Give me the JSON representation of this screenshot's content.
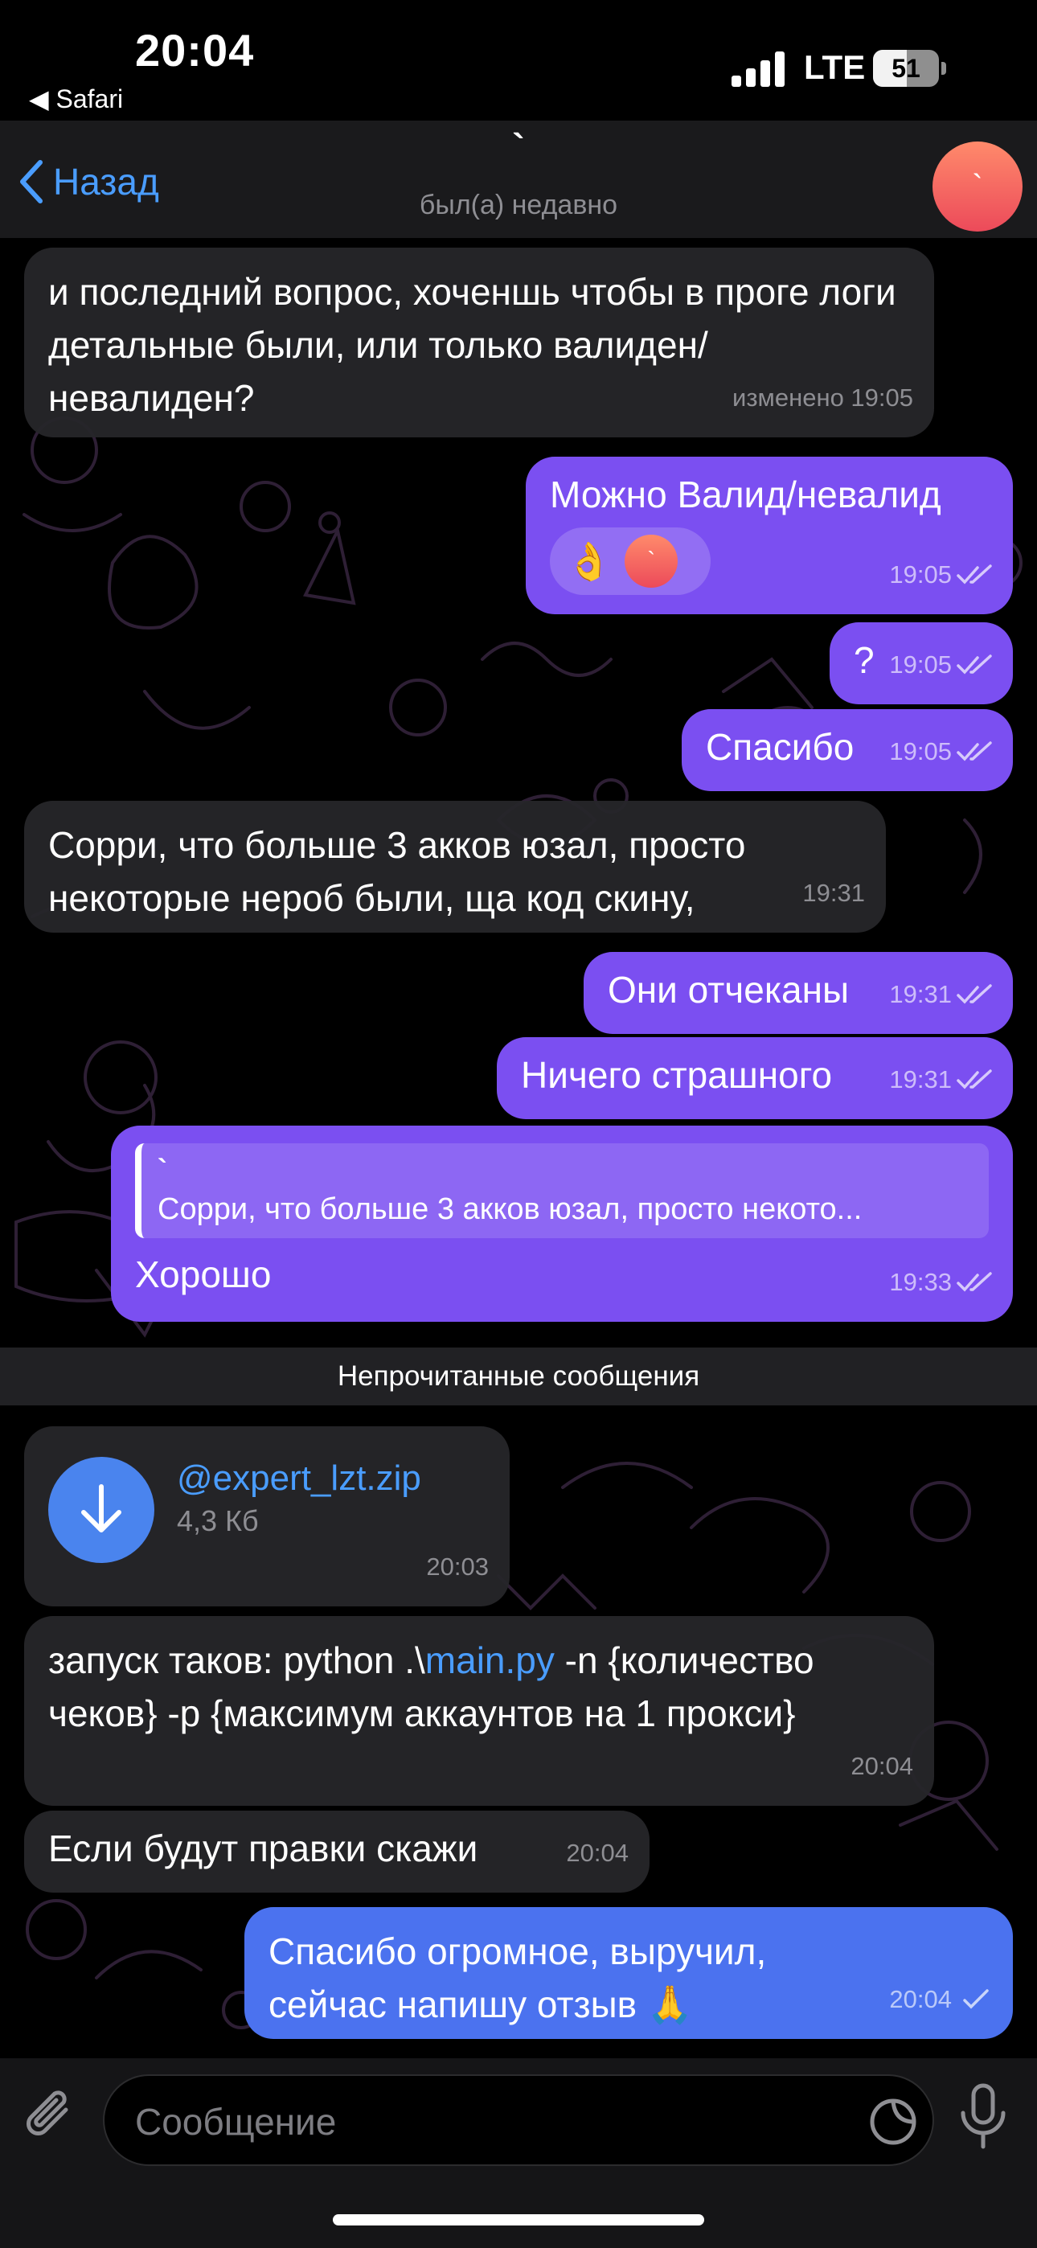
{
  "status_bar": {
    "time": "20:04",
    "back_app": "◀ Safari",
    "network": "LTE",
    "battery": "51",
    "battery_level": 0.51
  },
  "header": {
    "back_label": "Назад",
    "chat_name": "`",
    "status": "был(а) недавно",
    "avatar_letter": "`"
  },
  "messages": [
    {
      "dir": "in",
      "text": "и последний вопрос, хоченшь чтобы в проге логи детальные были, или только валиден/невалиден?",
      "time": "изменено 19:05"
    },
    {
      "dir": "out",
      "text": "Можно Валид/невалид",
      "time": "19:05",
      "reaction_emoji": "👌",
      "reaction_avatar": "`"
    },
    {
      "dir": "out",
      "text": "?",
      "time": "19:05"
    },
    {
      "dir": "out",
      "text": "Спасибо",
      "time": "19:05"
    },
    {
      "dir": "in",
      "text": "Сорри, что больше 3 акков юзал, просто некоторые нероб были, ща код скину,",
      "time": "19:31"
    },
    {
      "dir": "out",
      "text": "Они отчеканы",
      "time": "19:31"
    },
    {
      "dir": "out",
      "text": "Ничего страшного",
      "time": "19:31"
    },
    {
      "dir": "out",
      "text": "Хорошо",
      "time": "19:33",
      "reply_name": "`",
      "reply_text": "Сорри, что больше 3 акков юзал, просто некото..."
    },
    {
      "dir": "in",
      "type": "file",
      "file_name": "@expert_lzt.zip",
      "file_size": "4,3 Кб",
      "time": "20:03"
    },
    {
      "dir": "in",
      "text_before": "запуск таков: python .\\",
      "link": "main.py",
      "text_after": " -n {количество чеков} -p {максимум аккаунтов на 1 прокси}",
      "time": "20:04"
    },
    {
      "dir": "in",
      "text": "Если будут правки скажи",
      "time": "20:04"
    },
    {
      "dir": "out",
      "text": "Спасибо огромное, выручил, сейчас напишу отзыв 🙏",
      "time": "20:04"
    }
  ],
  "divider": "Непрочитанные сообщения",
  "input": {
    "placeholder": "Сообщение"
  },
  "icons": {
    "attach": "paperclip-icon",
    "sticker": "sticker-icon",
    "mic": "microphone-icon",
    "download": "download-arrow-icon"
  },
  "colors": {
    "outgoing": "#7b4ff1",
    "outgoing_pending": "#4b72ef",
    "incoming": "#262629",
    "accent": "#4a9dff"
  }
}
